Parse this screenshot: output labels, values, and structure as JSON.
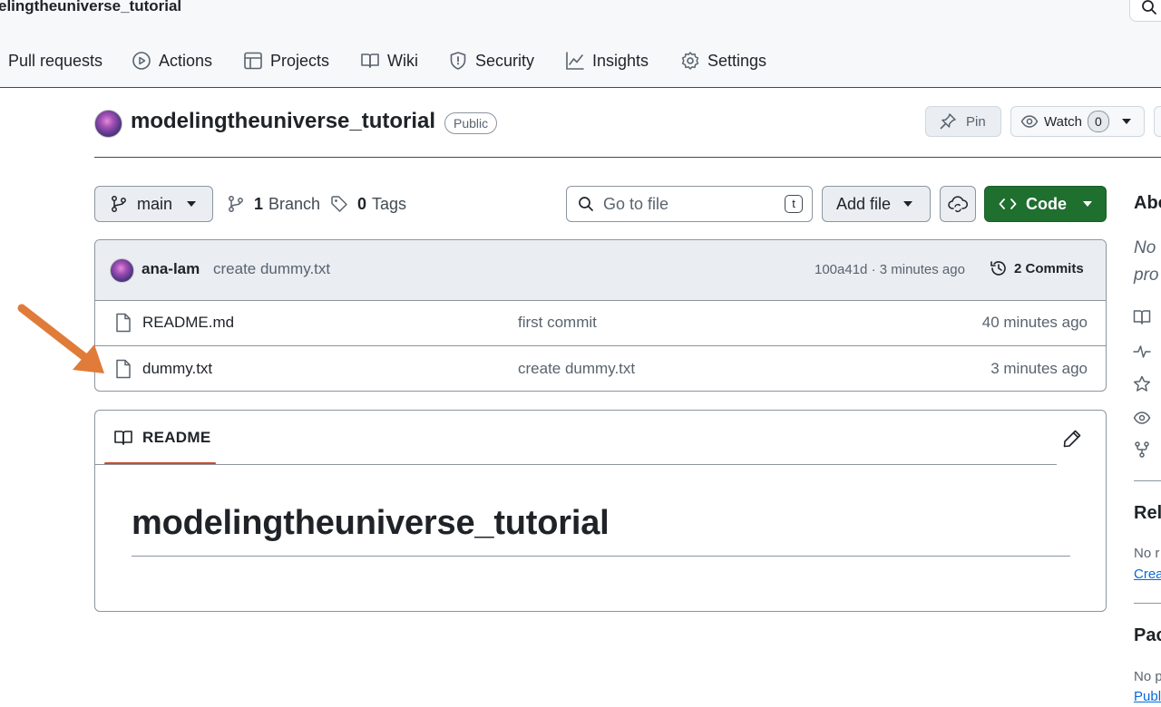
{
  "header": {
    "repo_crumb": "elingtheuniverse_tutorial",
    "nav": [
      {
        "label": "Pull requests",
        "icon": "pull-request-icon"
      },
      {
        "label": "Actions",
        "icon": "play-circle-icon"
      },
      {
        "label": "Projects",
        "icon": "table-icon"
      },
      {
        "label": "Wiki",
        "icon": "book-icon"
      },
      {
        "label": "Security",
        "icon": "shield-icon"
      },
      {
        "label": "Insights",
        "icon": "graph-icon"
      },
      {
        "label": "Settings",
        "icon": "gear-icon"
      }
    ]
  },
  "repo": {
    "name": "modelingtheuniverse_tutorial",
    "visibility": "Public",
    "pin_label": "Pin",
    "watch_label": "Watch",
    "watch_count": "0"
  },
  "toolbar": {
    "branch": "main",
    "branch_count": "1",
    "branch_label": "Branch",
    "tag_count": "0",
    "tag_label": "Tags",
    "goto_placeholder": "Go to file",
    "goto_shortcut": "t",
    "add_file_label": "Add file",
    "code_label": "Code"
  },
  "latest_commit": {
    "author": "ana-lam",
    "message": "create dummy.txt",
    "meta": "100a41d · 3 minutes ago",
    "commits_label": "2 Commits"
  },
  "files": [
    {
      "name": "README.md",
      "message": "first commit",
      "time": "40 minutes ago"
    },
    {
      "name": "dummy.txt",
      "message": "create dummy.txt",
      "time": "3 minutes ago"
    }
  ],
  "readme": {
    "tab_label": "README",
    "heading": "modelingtheuniverse_tutorial"
  },
  "sidebar": {
    "about_title": "Abo",
    "about_line1": "No",
    "about_line2": "pro",
    "releases_title": "Rel",
    "releases_text": "No r",
    "releases_link": "Crea",
    "packages_title": "Pac",
    "packages_text": "No p",
    "packages_link": "Publ"
  },
  "annotation": {
    "arrow_color": "#e07b39"
  },
  "colors": {
    "code_button": "#1f6f2f",
    "readme_tab_underline": "#c94b2d",
    "link": "#0969da"
  }
}
